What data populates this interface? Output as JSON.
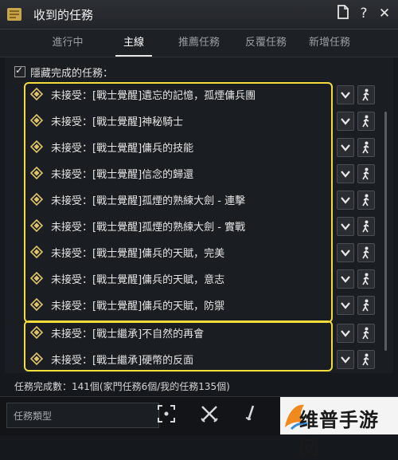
{
  "window": {
    "title": "收到的任務",
    "icons": [
      "app-logo-icon",
      "document-icon",
      "help-icon",
      "close-icon"
    ]
  },
  "tabs": [
    {
      "label": "進行中",
      "active": false
    },
    {
      "label": "主線",
      "active": true
    },
    {
      "label": "推薦任務",
      "active": false
    },
    {
      "label": "反覆任務",
      "active": false
    },
    {
      "label": "新增任務",
      "active": false
    }
  ],
  "hide_completed": {
    "label": "隱藏完成的任務：",
    "checked": true
  },
  "quests": [
    {
      "text": "未接受：[戰士覺醒]遺忘的記憶，孤煙傭兵團"
    },
    {
      "text": "未接受：[戰士覺醒]神秘騎士"
    },
    {
      "text": "未接受：[戰士覺醒]傭兵的技能"
    },
    {
      "text": "未接受：[戰士覺醒]信念的歸還"
    },
    {
      "text": "未接受：[戰士覺醒]孤煙的熟練大劍 - 連擊"
    },
    {
      "text": "未接受：[戰士覺醒]孤煙的熟練大劍 - 實戰"
    },
    {
      "text": "未接受：[戰士覺醒]傭兵的天賦，完美"
    },
    {
      "text": "未接受：[戰士覺醒]傭兵的天賦，意志"
    },
    {
      "text": "未接受：[戰士覺醒]傭兵的天賦，防禦"
    },
    {
      "text": "未接受：[戰士繼承]不自然的再會"
    },
    {
      "text": "未接受：[戰士繼承]硬幣的反面"
    }
  ],
  "summary": "任務完成數：141個(家門任務6個/我的任務135個)",
  "bottom": {
    "type_label": "任務類型"
  },
  "watermark": "维普手游网",
  "colors": {
    "highlight_border": "#f2dd3a",
    "background": "#15181c",
    "active_tab": "#ffffff"
  }
}
